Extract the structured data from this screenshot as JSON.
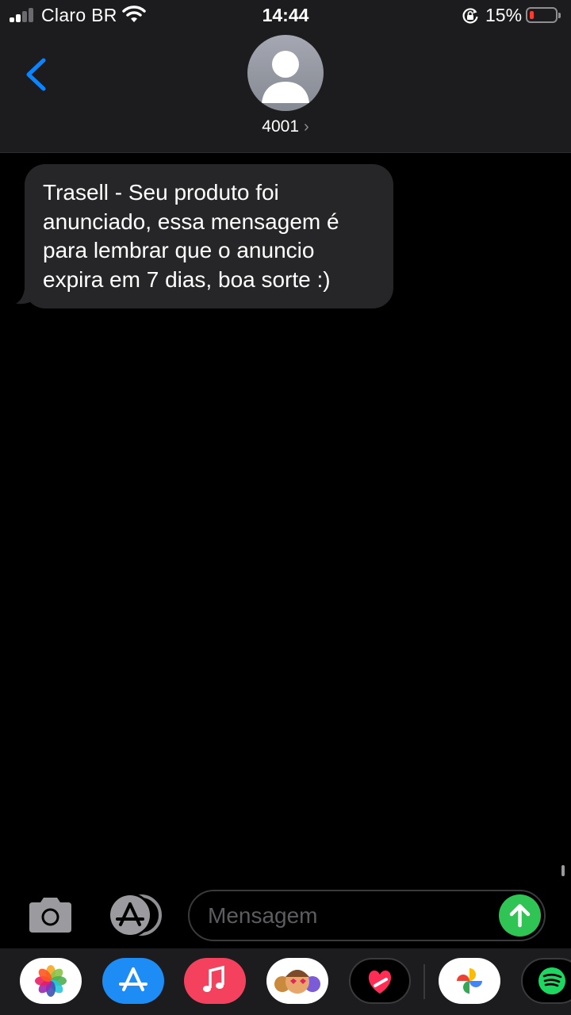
{
  "status_bar": {
    "carrier": "Claro BR",
    "time": "14:44",
    "battery_percent": "15%",
    "battery_level": 0.15,
    "icons": [
      "signal-icon",
      "wifi-icon",
      "orientation-lock-icon",
      "battery-icon"
    ]
  },
  "header": {
    "contact_name": "4001",
    "chevron": "›",
    "icons": [
      "back-chevron-icon",
      "contact-avatar-icon"
    ]
  },
  "messages": [
    {
      "direction": "incoming",
      "lines": [
        "Trasell - Seu produto foi",
        "anunciado, essa mensagem é",
        "para lembrar que o anuncio",
        "expira em 7 dias, boa sorte :)"
      ]
    }
  ],
  "compose": {
    "placeholder": "Mensagem",
    "icons": [
      "camera-icon",
      "app-store-icon",
      "send-arrow-icon"
    ]
  },
  "app_drawer": {
    "apps": [
      "photos-icon",
      "app-store-icon",
      "music-icon",
      "memoji-icon",
      "digital-touch-icon",
      "google-photos-icon",
      "spotify-icon"
    ]
  },
  "colors": {
    "accent_blue": "#0a84ff",
    "send_green": "#30c454",
    "bubble_gray": "#262628",
    "bar_background": "#1c1c1e",
    "battery_red": "#ff3b30"
  }
}
